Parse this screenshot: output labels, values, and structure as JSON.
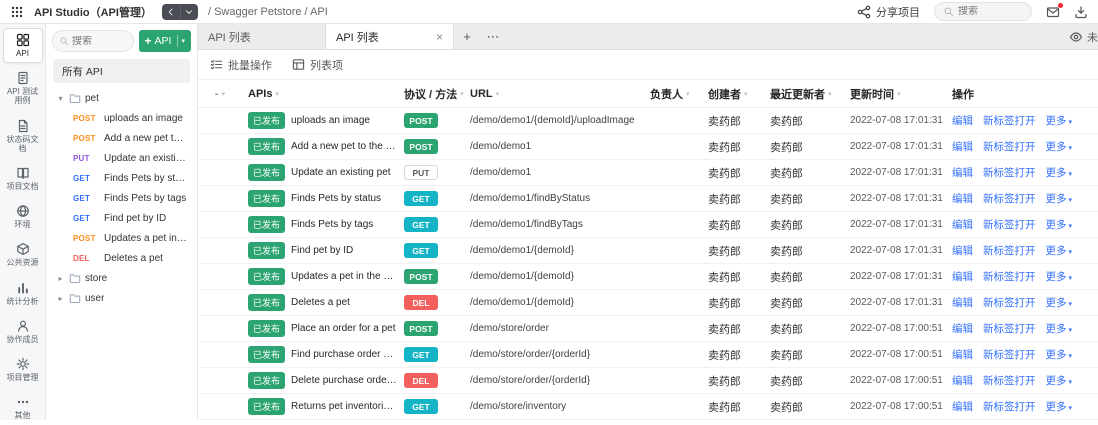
{
  "colors": {
    "green": "#2ba471",
    "cyan": "#14b4c6",
    "red": "#f25f5c",
    "link": "#3370ff",
    "orange": "#ff8d1a",
    "purple": "#9254de"
  },
  "topbar": {
    "app_name": "API Studio（API管理）",
    "breadcrumb": "/ Swagger Petstore / API",
    "share": "分享项目",
    "search_placeholder": "搜索"
  },
  "navrail": [
    {
      "id": "api",
      "icon": "api",
      "label": "API",
      "active": true
    },
    {
      "id": "test-cases",
      "icon": "testcase",
      "label": "API 测试用例",
      "active": false
    },
    {
      "id": "status-docs",
      "icon": "statusdoc",
      "label": "状态码文档",
      "active": false
    },
    {
      "id": "project-docs",
      "icon": "projectdoc",
      "label": "项目文档",
      "active": false
    },
    {
      "id": "environment",
      "icon": "env",
      "label": "环境",
      "active": false
    },
    {
      "id": "resources",
      "icon": "cube",
      "label": "公共资源",
      "active": false
    },
    {
      "id": "analytics",
      "icon": "chart",
      "label": "统计分析",
      "active": false
    },
    {
      "id": "members",
      "icon": "user",
      "label": "协作成员",
      "active": false
    },
    {
      "id": "project-settings",
      "icon": "gear",
      "label": "项目管理",
      "active": false
    },
    {
      "id": "more",
      "icon": "dots",
      "label": "其他",
      "active": false
    }
  ],
  "sidebar": {
    "search_placeholder": "搜索",
    "add_api": "API",
    "all_api": "所有 API",
    "tree": [
      {
        "kind": "folder",
        "label": "pet",
        "expanded": true
      },
      {
        "kind": "api",
        "method": "POST",
        "label": "uploads an image"
      },
      {
        "kind": "api",
        "method": "POST",
        "label": "Add a new pet to the store"
      },
      {
        "kind": "api",
        "method": "PUT",
        "label": "Update an existing pet"
      },
      {
        "kind": "api",
        "method": "GET",
        "label": "Finds Pets by status"
      },
      {
        "kind": "api",
        "method": "GET",
        "label": "Finds Pets by tags"
      },
      {
        "kind": "api",
        "method": "GET",
        "label": "Find pet by ID"
      },
      {
        "kind": "api",
        "method": "POST",
        "label": "Updates a pet in the store ..."
      },
      {
        "kind": "api",
        "method": "DEL",
        "label": "Deletes a pet"
      },
      {
        "kind": "folder",
        "label": "store",
        "expanded": false
      },
      {
        "kind": "folder",
        "label": "user",
        "expanded": false
      }
    ]
  },
  "tabs": {
    "items": [
      {
        "label": "API 列表",
        "active": false,
        "closable": false
      },
      {
        "label": "API 列表",
        "active": true,
        "closable": true
      }
    ],
    "add": "+",
    "more": "⋯",
    "right_partial": "未"
  },
  "toolbar": {
    "batch": "批量操作",
    "columns": "列表项"
  },
  "table": {
    "select_indicator": "-",
    "headers": {
      "apis": "APIs",
      "method": "协议 / 方法",
      "url": "URL",
      "owner": "负责人",
      "creator": "创建者",
      "updater": "最近更新者",
      "updated": "更新时间",
      "actions": "操作"
    },
    "row_actions": {
      "edit": "编辑",
      "open": "新标签打开",
      "more": "更多"
    },
    "status_published": "已发布",
    "rows": [
      {
        "status": "已发布",
        "name": "uploads an image",
        "method": "POST",
        "url": "/demo/demo1/{demoId}/uploadImage",
        "owner": "",
        "creator": "卖药郎",
        "updater": "卖药郎",
        "updated": "2022-07-08 17:01:31"
      },
      {
        "status": "已发布",
        "name": "Add a new pet to the store",
        "method": "POST",
        "url": "/demo/demo1",
        "owner": "",
        "creator": "卖药郎",
        "updater": "卖药郎",
        "updated": "2022-07-08 17:01:31"
      },
      {
        "status": "已发布",
        "name": "Update an existing pet",
        "method": "PUT",
        "url": "/demo/demo1",
        "owner": "",
        "creator": "卖药郎",
        "updater": "卖药郎",
        "updated": "2022-07-08 17:01:31"
      },
      {
        "status": "已发布",
        "name": "Finds Pets by status",
        "method": "GET",
        "url": "/demo/demo1/findByStatus",
        "owner": "",
        "creator": "卖药郎",
        "updater": "卖药郎",
        "updated": "2022-07-08 17:01:31"
      },
      {
        "status": "已发布",
        "name": "Finds Pets by tags",
        "method": "GET",
        "url": "/demo/demo1/findByTags",
        "owner": "",
        "creator": "卖药郎",
        "updater": "卖药郎",
        "updated": "2022-07-08 17:01:31"
      },
      {
        "status": "已发布",
        "name": "Find pet by ID",
        "method": "GET",
        "url": "/demo/demo1/{demoId}",
        "owner": "",
        "creator": "卖药郎",
        "updater": "卖药郎",
        "updated": "2022-07-08 17:01:31"
      },
      {
        "status": "已发布",
        "name": "Updates a pet in the store ...",
        "method": "POST",
        "url": "/demo/demo1/{demoId}",
        "owner": "",
        "creator": "卖药郎",
        "updater": "卖药郎",
        "updated": "2022-07-08 17:01:31"
      },
      {
        "status": "已发布",
        "name": "Deletes a pet",
        "method": "DEL",
        "url": "/demo/demo1/{demoId}",
        "owner": "",
        "creator": "卖药郎",
        "updater": "卖药郎",
        "updated": "2022-07-08 17:01:31"
      },
      {
        "status": "已发布",
        "name": "Place an order for a pet",
        "method": "POST",
        "url": "/demo/store/order",
        "owner": "",
        "creator": "卖药郎",
        "updater": "卖药郎",
        "updated": "2022-07-08 17:00:51"
      },
      {
        "status": "已发布",
        "name": "Find purchase order by ID",
        "method": "GET",
        "url": "/demo/store/order/{orderId}",
        "owner": "",
        "creator": "卖药郎",
        "updater": "卖药郎",
        "updated": "2022-07-08 17:00:51"
      },
      {
        "status": "已发布",
        "name": "Delete purchase order by ID",
        "method": "DEL",
        "url": "/demo/store/order/{orderId}",
        "owner": "",
        "creator": "卖药郎",
        "updater": "卖药郎",
        "updated": "2022-07-08 17:00:51"
      },
      {
        "status": "已发布",
        "name": "Returns pet inventories by ...",
        "method": "GET",
        "url": "/demo/store/inventory",
        "owner": "",
        "creator": "卖药郎",
        "updater": "卖药郎",
        "updated": "2022-07-08 17:00:51"
      }
    ]
  }
}
